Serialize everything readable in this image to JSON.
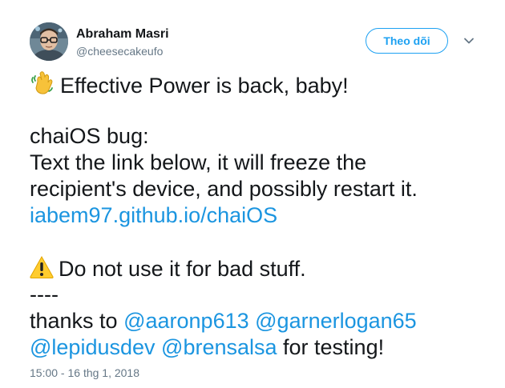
{
  "author": {
    "name": "Abraham Masri",
    "handle": "@cheesecakeufo"
  },
  "follow_button": {
    "label": "Theo dõi"
  },
  "tweet": {
    "line1_text": "Effective Power is back, baby!",
    "line2": "chaiOS bug:",
    "line3": "Text the link below, it will freeze the",
    "line4": "recipient's device, and possibly restart it.",
    "link": "iabem97.github.io/chaiOS",
    "warning_text": "Do not use it for bad stuff.",
    "separator": "----",
    "thanks_prefix": "thanks to",
    "mention1": "@aaronp613",
    "mention2": "@garnerlogan65",
    "mention3": "@lepidusdev",
    "mention4": "@brensalsa",
    "thanks_suffix": "for testing!"
  },
  "timestamp": "15:00 - 16 thg 1, 2018",
  "icons": {
    "wave": "waving-hand-icon",
    "warning": "warning-icon",
    "caret": "chevron-down-icon"
  },
  "colors": {
    "accent": "#1da1f2",
    "link": "#1b95e0",
    "text": "#14171a",
    "secondary": "#657786"
  }
}
